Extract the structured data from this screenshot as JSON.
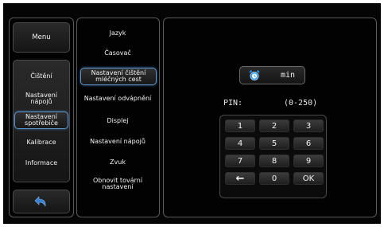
{
  "left": {
    "menu_label": "Menu",
    "items": [
      {
        "label": "Čištění"
      },
      {
        "label": "Nastavení nápojů"
      },
      {
        "label": "Nastavení spotřebiče"
      },
      {
        "label": "Kalibrace"
      },
      {
        "label": "Informace"
      }
    ],
    "selected_index": 2
  },
  "middle": {
    "items": [
      {
        "label": "Jazyk"
      },
      {
        "label": "Časovač"
      },
      {
        "label": "Nastavení čištění mléčných cest"
      },
      {
        "label": "Nastavení odvápnění"
      },
      {
        "label": "Displej"
      },
      {
        "label": "Nastavení nápojů"
      },
      {
        "label": "Zvuk"
      },
      {
        "label": "Obnovit tovární nastavení"
      }
    ],
    "selected_index": 2
  },
  "right": {
    "timer_unit": "min",
    "pin_label": "PIN:",
    "range_label": "(0-250)",
    "keypad": [
      [
        "1",
        "2",
        "3"
      ],
      [
        "4",
        "5",
        "6"
      ],
      [
        "7",
        "8",
        "9"
      ],
      [
        "←",
        "0",
        "OK"
      ]
    ]
  },
  "icons": {
    "back": "back-arrow-icon",
    "alarm": "alarm-clock-icon"
  },
  "colors": {
    "accent": "#5f94c8",
    "background": "#050505",
    "panel_border": "#5a5a5a"
  }
}
